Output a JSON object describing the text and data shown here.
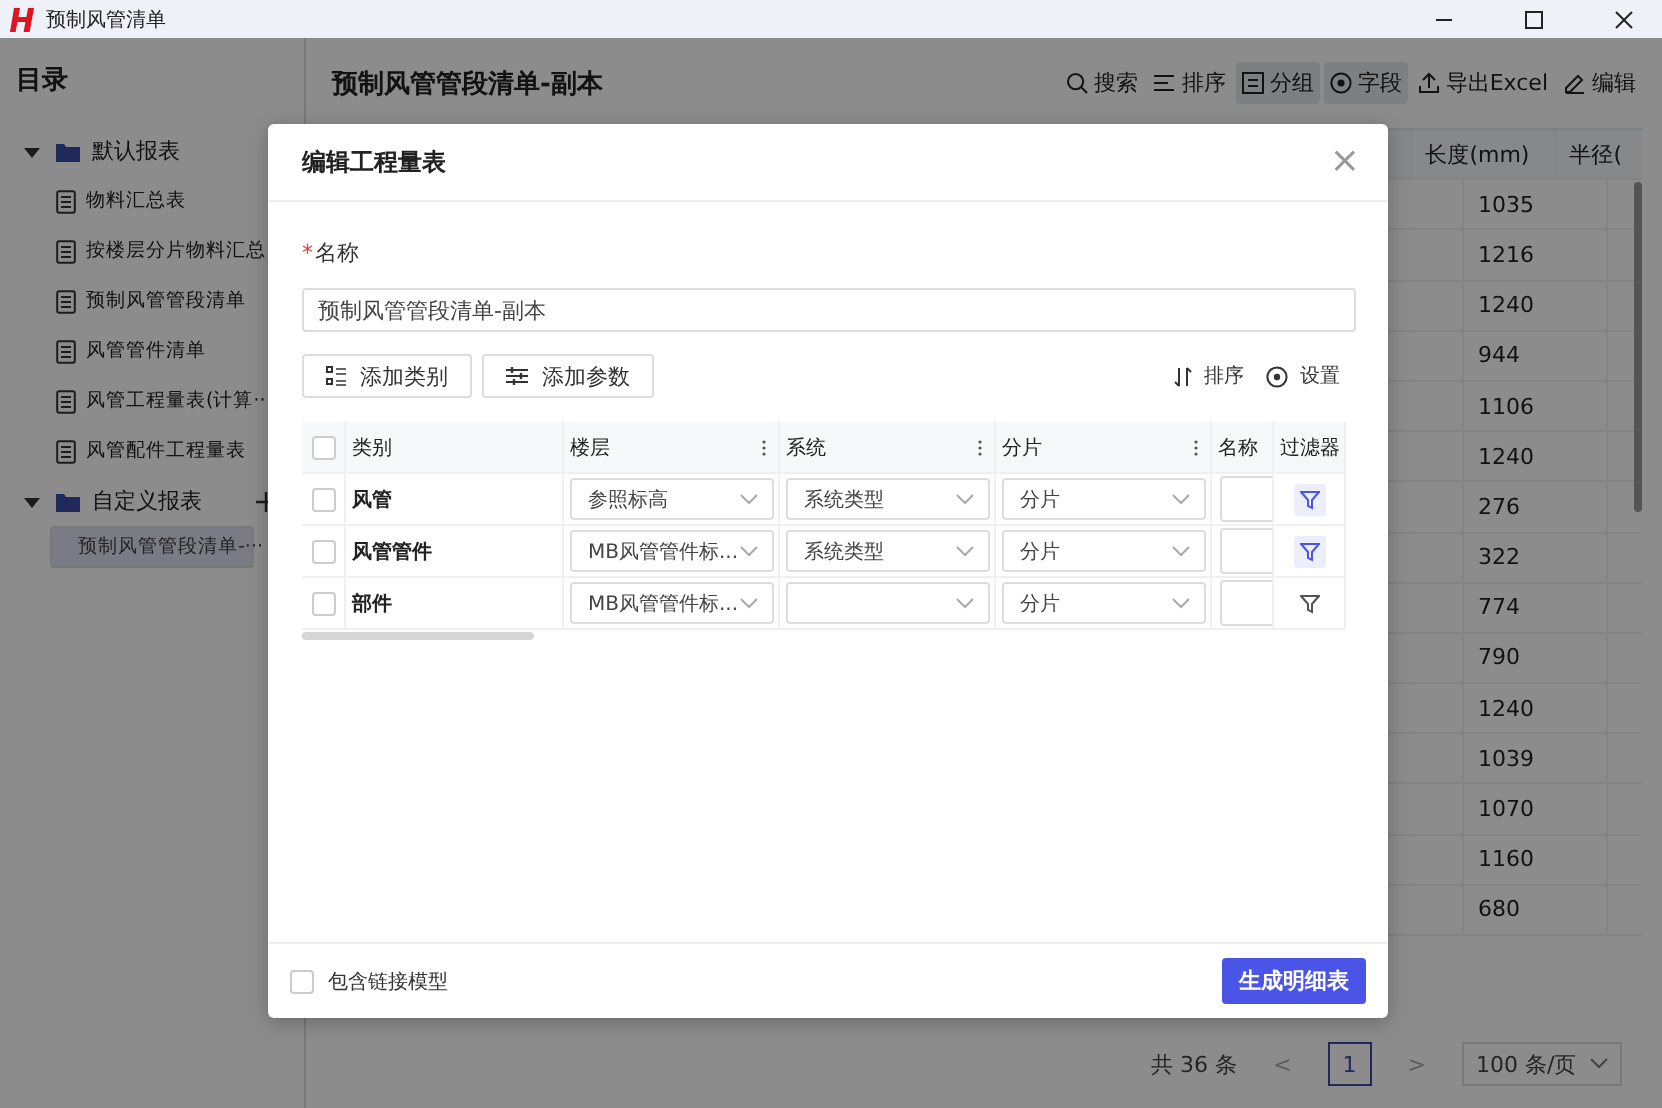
{
  "window": {
    "title": "预制风管清单"
  },
  "sidebar": {
    "title": "目录",
    "groups": [
      {
        "label": "默认报表",
        "expanded": true,
        "add_button": false,
        "children": [
          {
            "label": "物料汇总表",
            "selected": false
          },
          {
            "label": "按楼层分片物料汇总",
            "selected": false
          },
          {
            "label": "预制风管管段清单",
            "selected": false
          },
          {
            "label": "风管管件清单",
            "selected": false
          },
          {
            "label": "风管工程量表(计算··",
            "selected": false
          },
          {
            "label": "风管配件工程量表",
            "selected": false
          }
        ]
      },
      {
        "label": "自定义报表",
        "expanded": true,
        "add_button": true,
        "children": [
          {
            "label": "预制风管管段清单-···",
            "selected": true
          }
        ]
      }
    ]
  },
  "main": {
    "title": "预制风管管段清单-副本",
    "toolbar": [
      {
        "kind": "search",
        "label": "搜索",
        "active": false
      },
      {
        "kind": "sort",
        "label": "排序",
        "active": false
      },
      {
        "kind": "group",
        "label": "分组",
        "active": true
      },
      {
        "kind": "field",
        "label": "字段",
        "active": true
      },
      {
        "kind": "export",
        "label": "导出Excel",
        "active": false
      },
      {
        "kind": "edit",
        "label": "编辑",
        "active": false
      }
    ],
    "table": {
      "columns": [
        "长度(mm)",
        "半径("
      ],
      "rows": [
        [
          "1035"
        ],
        [
          "1216"
        ],
        [
          "1240"
        ],
        [
          "944"
        ],
        [
          "1106"
        ],
        [
          "1240"
        ],
        [
          "276"
        ],
        [
          "322"
        ],
        [
          "774"
        ],
        [
          "790"
        ],
        [
          "1240"
        ],
        [
          "1039"
        ],
        [
          "1070"
        ],
        [
          "1160"
        ],
        [
          "680"
        ]
      ]
    },
    "pagination": {
      "total": "共 36 条",
      "prev": "<",
      "pages": [
        {
          "label": "1",
          "selected": true
        }
      ],
      "next": ">",
      "page_size": "100 条/页"
    }
  },
  "dialog": {
    "title": "编辑工程量表",
    "close": "×",
    "name_label": "名称",
    "required_mark": "*",
    "name_value": "预制风管管段清单-副本",
    "left_buttons": [
      {
        "kind": "category",
        "label": "添加类别"
      },
      {
        "kind": "param",
        "label": "添加参数"
      }
    ],
    "right_buttons": [
      {
        "kind": "sort",
        "label": "排序"
      },
      {
        "kind": "settings",
        "label": "设置"
      }
    ],
    "table": {
      "columns": [
        {
          "label": "类别",
          "menu": false
        },
        {
          "label": "楼层",
          "menu": true
        },
        {
          "label": "系统",
          "menu": true
        },
        {
          "label": "分片",
          "menu": true
        },
        {
          "label": "名称",
          "menu": false
        },
        {
          "label": "过滤器",
          "menu": false
        }
      ],
      "header_checked": false,
      "rows": [
        {
          "checked": false,
          "category": "风管",
          "floor": "参照标高",
          "system": "系统类型",
          "slice": "分片",
          "filter_active": true
        },
        {
          "checked": false,
          "category": "风管管件",
          "floor": "MB风管管件标...",
          "system": "系统类型",
          "slice": "分片",
          "filter_active": true
        },
        {
          "checked": false,
          "category": "部件",
          "floor": "MB风管管件标...",
          "system": "",
          "slice": "分片",
          "filter_active": false
        }
      ]
    },
    "include_linked": {
      "label": "包含链接模型",
      "checked": false
    },
    "submit": "生成明细表"
  }
}
